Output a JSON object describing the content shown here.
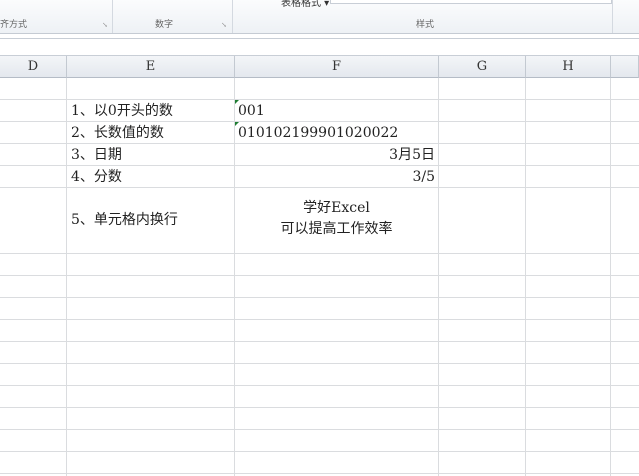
{
  "ribbon": {
    "groups": [
      "齐方式",
      "数字",
      "样式"
    ],
    "table_format": "表格格式 ▾"
  },
  "columns": [
    "D",
    "E",
    "F",
    "G",
    "H"
  ],
  "cells": {
    "e1": "1、以0开头的数",
    "f1": "001",
    "e2": "2、长数值的数",
    "f2": "010102199901020022",
    "e3": "3、日期",
    "f3": "3月5日",
    "e4": "4、分数",
    "f4": "3/5",
    "e5": "5、单元格内换行",
    "f5_line1": "学好Excel",
    "f5_line2": "可以提高工作效率"
  }
}
